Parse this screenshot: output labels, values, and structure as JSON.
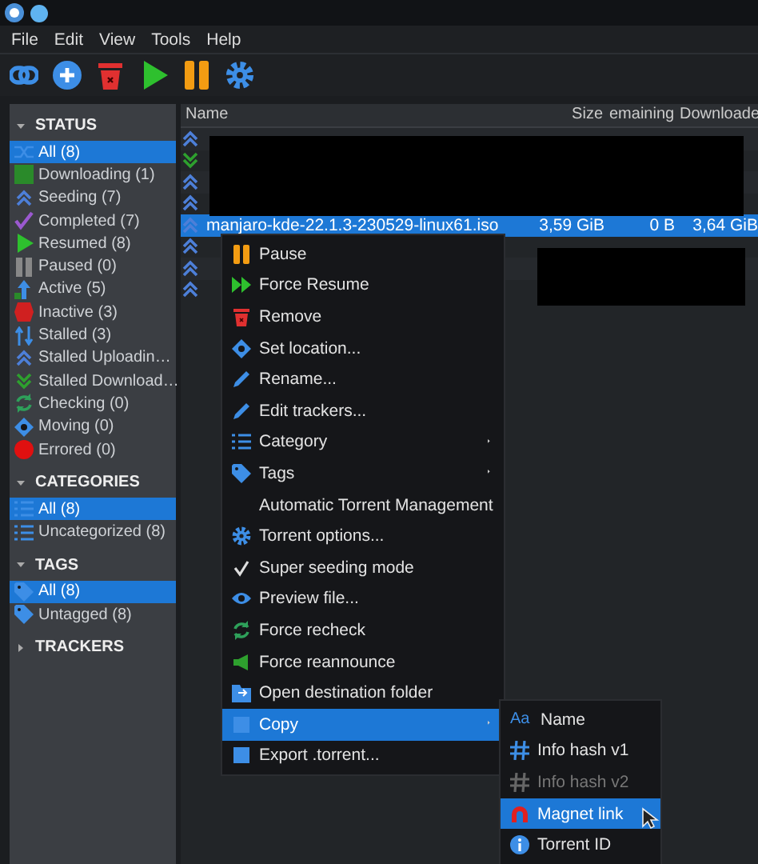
{
  "menubar": [
    "File",
    "Edit",
    "View",
    "Tools",
    "Help"
  ],
  "sidebar": [
    {
      "title": "STATUS",
      "expanded": true,
      "items": [
        {
          "label": "All (8)",
          "selected": true
        },
        {
          "label": "Downloading (1)",
          "selected": false
        },
        {
          "label": "Seeding (7)",
          "selected": false
        },
        {
          "label": "Completed (7)",
          "selected": false
        },
        {
          "label": "Resumed (8)",
          "selected": false
        },
        {
          "label": "Paused (0)",
          "selected": false
        },
        {
          "label": "Active (5)",
          "selected": false
        },
        {
          "label": "Inactive (3)",
          "selected": false
        },
        {
          "label": "Stalled (3)",
          "selected": false
        },
        {
          "label": "Stalled Uploadin…",
          "selected": false
        },
        {
          "label": "Stalled Download…",
          "selected": false
        },
        {
          "label": "Checking (0)",
          "selected": false
        },
        {
          "label": "Moving (0)",
          "selected": false
        },
        {
          "label": "Errored (0)",
          "selected": false
        }
      ]
    },
    {
      "title": "CATEGORIES",
      "expanded": true,
      "items": [
        {
          "label": "All (8)",
          "selected": true
        },
        {
          "label": "Uncategorized (8)",
          "selected": false
        }
      ]
    },
    {
      "title": "TAGS",
      "expanded": true,
      "items": [
        {
          "label": "All (8)",
          "selected": true
        },
        {
          "label": "Untagged (8)",
          "selected": false
        }
      ]
    },
    {
      "title": "TRACKERS",
      "expanded": false
    }
  ],
  "table": {
    "columns": [
      "Name",
      "Size",
      "emaining",
      "Downloade"
    ],
    "rows": [
      {
        "kind": "seeding",
        "selected": false,
        "cells": []
      },
      {
        "kind": "downloading",
        "selected": false,
        "cells": []
      },
      {
        "kind": "seeding",
        "selected": false,
        "cells": []
      },
      {
        "kind": "seeding",
        "selected": false,
        "cells": []
      },
      {
        "kind": "seeding",
        "selected": true,
        "cells": [
          "manjaro-kde-22.1.3-230529-linux61.iso",
          "3,59 GiB",
          "0 B",
          "3,64 GiB"
        ]
      },
      {
        "kind": "seeding",
        "selected": false,
        "cells": []
      },
      {
        "kind": "seeding",
        "selected": false,
        "cells": []
      },
      {
        "kind": "seeding",
        "selected": false,
        "cells": []
      }
    ]
  },
  "context_menu": {
    "items": [
      {
        "label": "Pause",
        "kind": "action",
        "selected": false
      },
      {
        "label": "Force Resume",
        "kind": "action",
        "selected": false
      },
      {
        "label": "Remove",
        "kind": "action",
        "selected": false
      },
      {
        "label": "Set location...",
        "kind": "action",
        "selected": false
      },
      {
        "label": "Rename...",
        "kind": "action",
        "selected": false
      },
      {
        "label": "Edit trackers...",
        "kind": "action",
        "selected": false
      },
      {
        "label": "Category",
        "kind": "submenu",
        "selected": false
      },
      {
        "label": "Tags",
        "kind": "submenu",
        "selected": false
      },
      {
        "label": "Automatic Torrent Management",
        "kind": "toggle",
        "checked": false,
        "selected": false
      },
      {
        "label": "Torrent options...",
        "kind": "action",
        "selected": false
      },
      {
        "label": "Super seeding mode",
        "kind": "toggle",
        "checked": true,
        "selected": false
      },
      {
        "label": "Preview file...",
        "kind": "action",
        "selected": false
      },
      {
        "label": "Force recheck",
        "kind": "action",
        "selected": false
      },
      {
        "label": "Force reannounce",
        "kind": "action",
        "selected": false
      },
      {
        "label": "Open destination folder",
        "kind": "action",
        "selected": false
      },
      {
        "label": "Copy",
        "kind": "submenu",
        "selected": true
      },
      {
        "label": "Export .torrent...",
        "kind": "action",
        "selected": false
      }
    ]
  },
  "copy_submenu": {
    "items": [
      {
        "label": "Name",
        "glyph": "Aa",
        "selected": false,
        "disabled": false
      },
      {
        "label": "Info hash v1",
        "selected": false,
        "disabled": false
      },
      {
        "label": "Info hash v2",
        "selected": false,
        "disabled": true
      },
      {
        "label": "Magnet link",
        "selected": true,
        "disabled": false
      },
      {
        "label": "Torrent ID",
        "selected": false,
        "disabled": false
      }
    ]
  }
}
